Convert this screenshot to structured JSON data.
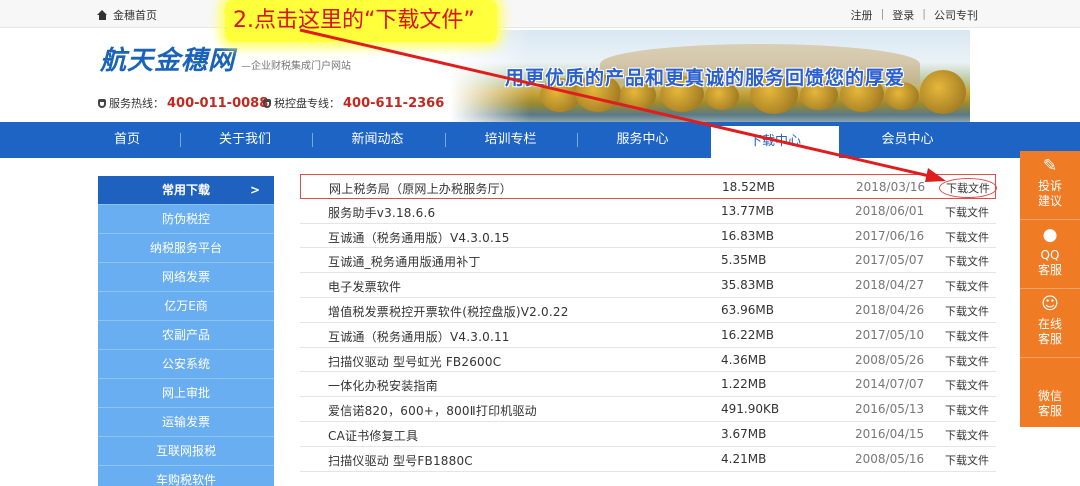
{
  "topbar": {
    "home_label": "金穗首页",
    "links": [
      "注册",
      "登录",
      "公司专刊"
    ]
  },
  "annotation": {
    "text": "2.点击这里的“下载文件”"
  },
  "header": {
    "logo_name": "航天金穗网",
    "logo_slogan": "—企业财税集成门户网站",
    "hotline_label": "服务热线：",
    "hotline_number": "400-011-0088",
    "tax_label": "税控盘专线：",
    "tax_number": "400-611-2366",
    "banner_slogan": "用更优质的产品和更真诚的服务回馈您的厚爱"
  },
  "nav": {
    "items": [
      "首页",
      "关于我们",
      "新闻动态",
      "培训专栏",
      "服务中心",
      "下载中心",
      "会员中心"
    ],
    "active": "下载中心"
  },
  "sidebar": {
    "items": [
      "常用下载",
      "防伪税控",
      "纳税服务平台",
      "网络发票",
      "亿万E商",
      "农副产品",
      "公安系统",
      "网上审批",
      "运输发票",
      "互联网报税",
      "车购税软件"
    ],
    "active_arrow": ">"
  },
  "downloads": [
    {
      "name": "网上税务局（原网上办税服务厅）",
      "size": "18.52MB",
      "date": "2018/03/16",
      "action": "下载文件"
    },
    {
      "name": "服务助手v3.18.6.6",
      "size": "13.77MB",
      "date": "2018/06/01",
      "action": "下载文件"
    },
    {
      "name": "互诚通（税务通用版）V4.3.0.15",
      "size": "16.83MB",
      "date": "2017/06/16",
      "action": "下载文件"
    },
    {
      "name": "互诚通_税务通用版通用补丁",
      "size": "5.35MB",
      "date": "2017/05/07",
      "action": "下载文件"
    },
    {
      "name": "电子发票软件",
      "size": "35.83MB",
      "date": "2018/04/27",
      "action": "下载文件"
    },
    {
      "name": "增值税发票税控开票软件(税控盘版)V2.0.22",
      "size": "63.96MB",
      "date": "2018/04/26",
      "action": "下载文件"
    },
    {
      "name": "互诚通（税务通用版）V4.3.0.11",
      "size": "16.22MB",
      "date": "2017/05/10",
      "action": "下载文件"
    },
    {
      "name": "扫描仪驱动 型号虹光 FB2600C",
      "size": "4.36MB",
      "date": "2008/05/26",
      "action": "下载文件"
    },
    {
      "name": "一体化办税安装指南",
      "size": "1.22MB",
      "date": "2014/07/07",
      "action": "下载文件"
    },
    {
      "name": "爱信诺820，600+，800Ⅱ打印机驱动",
      "size": "491.90KB",
      "date": "2016/05/13",
      "action": "下载文件"
    },
    {
      "name": "CA证书修复工具",
      "size": "3.67MB",
      "date": "2016/04/15",
      "action": "下载文件"
    },
    {
      "name": "扫描仪驱动 型号FB1880C",
      "size": "4.21MB",
      "date": "2008/05/16",
      "action": "下载文件"
    }
  ],
  "float_bar": {
    "complaint": [
      "投诉",
      "建议"
    ],
    "qq": [
      "QQ",
      "客服"
    ],
    "online": [
      "在线",
      "客服"
    ],
    "wechat": [
      "微信",
      "客服"
    ]
  },
  "colors": {
    "nav_blue": "#1d64c4",
    "sidebar_blue": "#6aaef2",
    "float_orange": "#f07b25",
    "annotation_red": "#d11111"
  }
}
